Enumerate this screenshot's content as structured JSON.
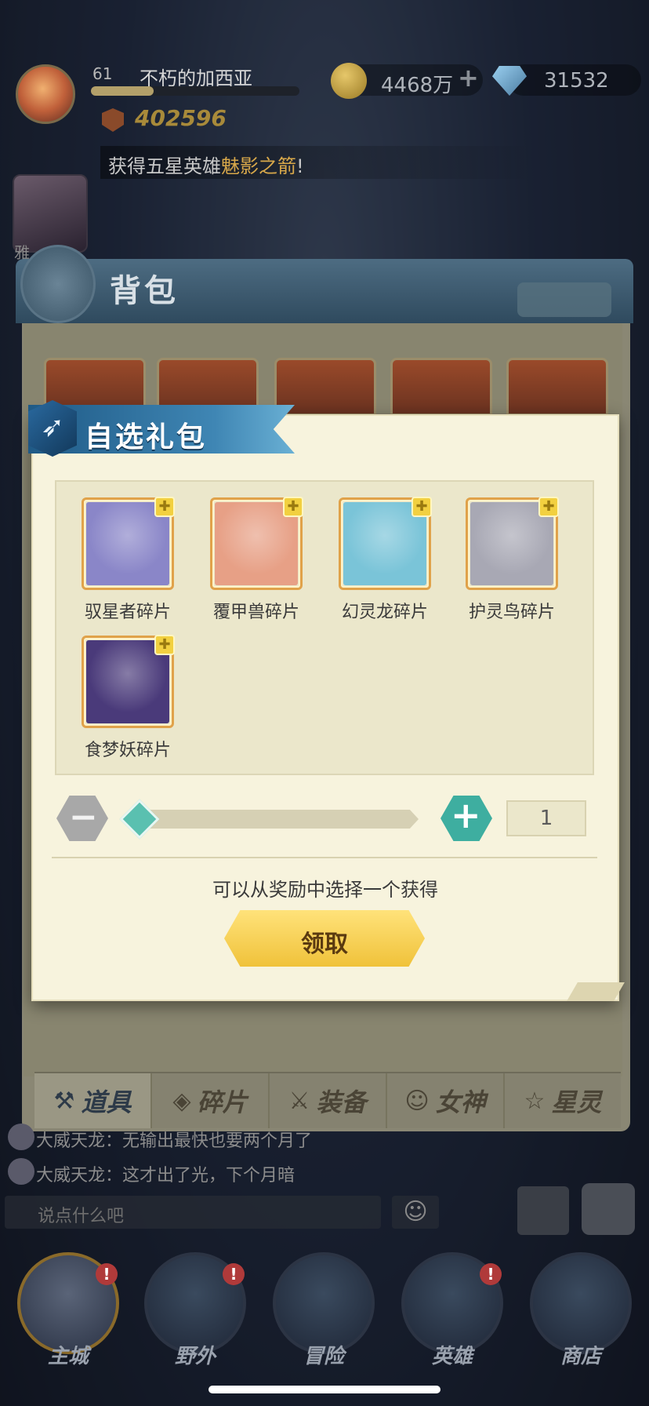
{
  "player": {
    "level": "61",
    "name": "不朽的加西亚",
    "xp_progress": 0.3,
    "power": "402596"
  },
  "currency": {
    "gold": "4468万",
    "diamonds": "31532",
    "plus": "+"
  },
  "announcement": {
    "prefix": "获得五星英雄",
    "highlight": "魅影之箭",
    "suffix": "!"
  },
  "side_hero": {
    "label": "雅..."
  },
  "bag": {
    "title": "背包",
    "tabs": [
      {
        "label": "道具",
        "icon": "item-icon",
        "active": true
      },
      {
        "label": "碎片",
        "icon": "fragment-icon",
        "active": false
      },
      {
        "label": "装备",
        "icon": "equipment-icon",
        "active": false
      },
      {
        "label": "女神",
        "icon": "goddess-icon",
        "active": false
      },
      {
        "label": "星灵",
        "icon": "star-spirit-icon",
        "active": false
      }
    ]
  },
  "dialog": {
    "title": "自选礼包",
    "rewards": [
      {
        "name": "驭星者碎片",
        "color": "#8a86c8"
      },
      {
        "name": "覆甲兽碎片",
        "color": "#e7a086"
      },
      {
        "name": "幻灵龙碎片",
        "color": "#7ac4d8"
      },
      {
        "name": "护灵鸟碎片",
        "color": "#a8a8b4"
      },
      {
        "name": "食梦妖碎片",
        "color": "#4a3a7a"
      }
    ],
    "quantity": "1",
    "hint": "可以从奖励中选择一个获得",
    "claim_label": "领取"
  },
  "chat": {
    "lines": [
      "大威天龙：无输出最快也要两个月了",
      "大威天龙：这才出了光，下个月暗"
    ],
    "placeholder": "说点什么吧"
  },
  "nav": [
    {
      "label": "主城",
      "badge": "!",
      "active": true
    },
    {
      "label": "野外",
      "badge": "!",
      "active": false
    },
    {
      "label": "冒险",
      "badge": "",
      "active": false
    },
    {
      "label": "英雄",
      "badge": "!",
      "active": false
    },
    {
      "label": "商店",
      "badge": "",
      "active": false
    }
  ]
}
